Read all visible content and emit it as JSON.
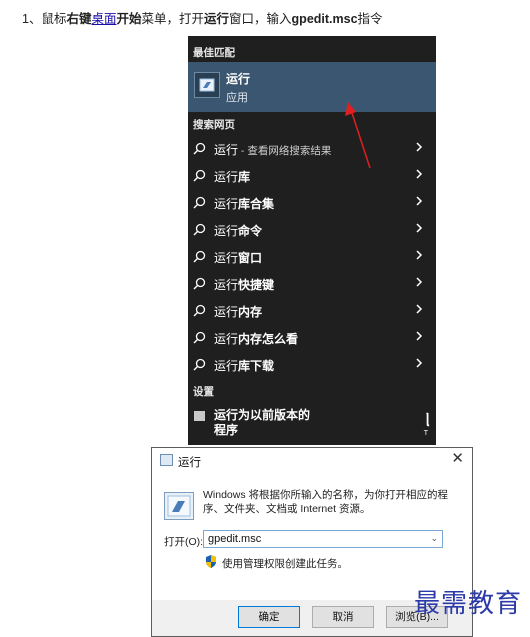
{
  "instruction": {
    "prefix": "1、鼠标",
    "bold1": "右键",
    "link": "桌面",
    "bold2": "开始",
    "mid": "菜单，打开",
    "bold3": "运行",
    "mid2": "窗口，输入",
    "bold4": "gpedit.msc",
    "suffix": "指令"
  },
  "start_menu": {
    "best_match_header": "最佳匹配",
    "best_match": {
      "title": "运行",
      "subtitle": "应用"
    },
    "web_header": "搜索网页",
    "web_items": [
      {
        "prefix": "运行",
        "rest": " - 查看网络搜索结果",
        "bold": false
      },
      {
        "prefix": "运行",
        "rest": "库",
        "bold": true
      },
      {
        "prefix": "运行",
        "rest": "库合集",
        "bold": true
      },
      {
        "prefix": "运行",
        "rest": "命令",
        "bold": true
      },
      {
        "prefix": "运行",
        "rest": "窗口",
        "bold": true
      },
      {
        "prefix": "运行",
        "rest": "快捷键",
        "bold": true
      },
      {
        "prefix": "运行",
        "rest": "内存",
        "bold": true
      },
      {
        "prefix": "运行",
        "rest": "内存怎么看",
        "bold": true
      },
      {
        "prefix": "运行",
        "rest": "库下载",
        "bold": true
      }
    ],
    "settings_header": "设置",
    "settings_item": {
      "line1": "运行为以前版本的",
      "line2": "程序",
      "trailing": "ᥣ",
      "trailing_small": "T"
    }
  },
  "run_dialog": {
    "title": "运行",
    "close": "✕",
    "description": "Windows 将根据你所输入的名称，为你打开相应的程序、文件夹、文档或 Internet 资源。",
    "open_label": "打开(O):",
    "open_value": "gpedit.msc",
    "admin_note": "使用管理权限创建此任务。",
    "ok": "确定",
    "cancel": "取消",
    "browse": "浏览(B)..."
  },
  "watermark": "最需教育",
  "colors": {
    "menu_bg": "#1f1f1f",
    "highlight": "#3b5670",
    "arrow": "#e02020",
    "link": "#1a0dab",
    "watermark": "#2b3aa8"
  },
  "icons": {
    "search": "magnifier-icon",
    "chevron": "chevron-right-icon",
    "app": "run-app-icon",
    "shield": "uac-shield-icon"
  }
}
